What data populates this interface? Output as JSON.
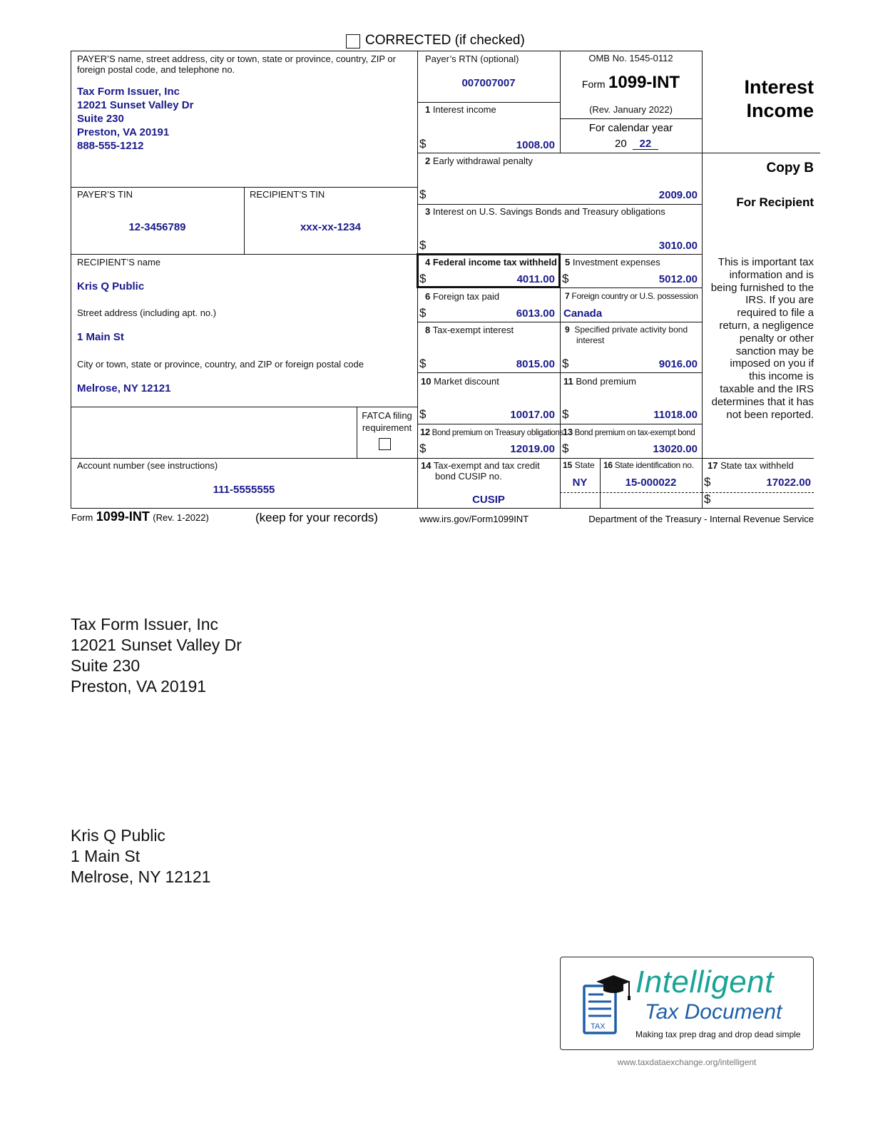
{
  "header": {
    "corrected_label": "CORRECTED (if checked)",
    "corrected_checked": false
  },
  "payer": {
    "label": "PAYER’S name, street address, city or town, state or province, country, ZIP or foreign postal code, and telephone no.",
    "lines": [
      "Tax Form Issuer, Inc",
      "12021 Sunset Valley Dr",
      "Suite 230",
      "Preston, VA 20191",
      "888-555-1212"
    ],
    "tin_label": "PAYER’S TIN",
    "tin": "12-3456789",
    "rtn_label": "Payer’s RTN (optional)",
    "rtn": "007007007"
  },
  "recipient": {
    "tin_label": "RECIPIENT’S TIN",
    "tin": "xxx-xx-1234",
    "name_label": "RECIPIENT’S name",
    "name": "Kris Q Public",
    "street_label": "Street address (including apt. no.)",
    "street": "1 Main St",
    "city_label": "City or town, state or province, country, and ZIP or foreign postal code",
    "city": "Melrose, NY 12121"
  },
  "fatca": {
    "label_line1": "FATCA filing",
    "label_line2": "requirement",
    "checked": false
  },
  "account": {
    "label": "Account number (see instructions)",
    "value": "111-5555555"
  },
  "form_info": {
    "omb": "OMB No. 1545-0112",
    "form_prefix": "Form",
    "form_name": "1099-INT",
    "rev": "(Rev. January 2022)",
    "calendar_label": "For calendar year",
    "year_prefix": "20",
    "year_suffix": "22",
    "title_line1": "Interest",
    "title_line2": "Income",
    "copy": "Copy B",
    "for_recipient": "For Recipient",
    "notice_lines": [
      "This is important tax",
      "information and is",
      "being furnished to the",
      "IRS. If you are",
      "required to file a",
      "return, a negligence",
      "penalty or other",
      "sanction may be",
      "imposed on you if",
      "this income is",
      "taxable and the IRS",
      "determines that it has",
      "not been reported."
    ]
  },
  "currency_symbol": "$",
  "boxes": {
    "b1": {
      "num": "1",
      "label": "Interest income",
      "value": "1008.00"
    },
    "b2": {
      "num": "2",
      "label": "Early withdrawal penalty",
      "value": "2009.00"
    },
    "b3": {
      "num": "3",
      "label": "Interest on U.S. Savings Bonds and Treasury obligations",
      "value": "3010.00"
    },
    "b4": {
      "num": "4",
      "label": "Federal income tax withheld",
      "value": "4011.00"
    },
    "b5": {
      "num": "5",
      "label": "Investment expenses",
      "value": "5012.00"
    },
    "b6": {
      "num": "6",
      "label": "Foreign tax paid",
      "value": "6013.00"
    },
    "b7": {
      "num": "7",
      "label": "Foreign country or U.S. possession",
      "value": "Canada"
    },
    "b8": {
      "num": "8",
      "label": "Tax-exempt interest",
      "value": "8015.00"
    },
    "b9": {
      "num": "9",
      "label_line1": "Specified private activity bond",
      "label_line2": "interest",
      "value": "9016.00"
    },
    "b10": {
      "num": "10",
      "label": "Market discount",
      "value": "10017.00"
    },
    "b11": {
      "num": "11",
      "label": "Bond premium",
      "value": "11018.00"
    },
    "b12": {
      "num": "12",
      "label": "Bond premium on Treasury obligations",
      "value": "12019.00"
    },
    "b13": {
      "num": "13",
      "label": "Bond premium on tax-exempt bond",
      "value": "13020.00"
    },
    "b14": {
      "num": "14",
      "label_line1": "Tax-exempt and tax credit",
      "label_line2": "bond CUSIP no.",
      "value": "CUSIP"
    },
    "b15": {
      "num": "15",
      "label": "State",
      "value": "NY"
    },
    "b16": {
      "num": "16",
      "label": "State identification no.",
      "value": "15-000022"
    },
    "b17": {
      "num": "17",
      "label": "State tax withheld",
      "value": "17022.00"
    }
  },
  "footer": {
    "form_prefix": "Form",
    "form_name": "1099-INT",
    "rev": "(Rev. 1-2022)",
    "keep": "(keep for your records)",
    "url": "www.irs.gov/Form1099INT",
    "dept": "Department of the Treasury - Internal Revenue Service"
  },
  "mailing": {
    "sender": [
      "Tax Form Issuer, Inc",
      "12021 Sunset Valley Dr",
      "Suite 230",
      "Preston, VA 20191"
    ],
    "recipient": [
      "Kris Q Public",
      "1 Main St",
      "Melrose, NY 12121"
    ]
  },
  "logo": {
    "title": "Intelligent",
    "subtitle": "Tax Document",
    "tagline": "Making tax prep drag and drop dead simple",
    "doc_tag": "TAX",
    "url": "www.taxdataexchange.org/intelligent",
    "colors": {
      "teal": "#1aa396",
      "blue": "#1f5ea8"
    }
  }
}
